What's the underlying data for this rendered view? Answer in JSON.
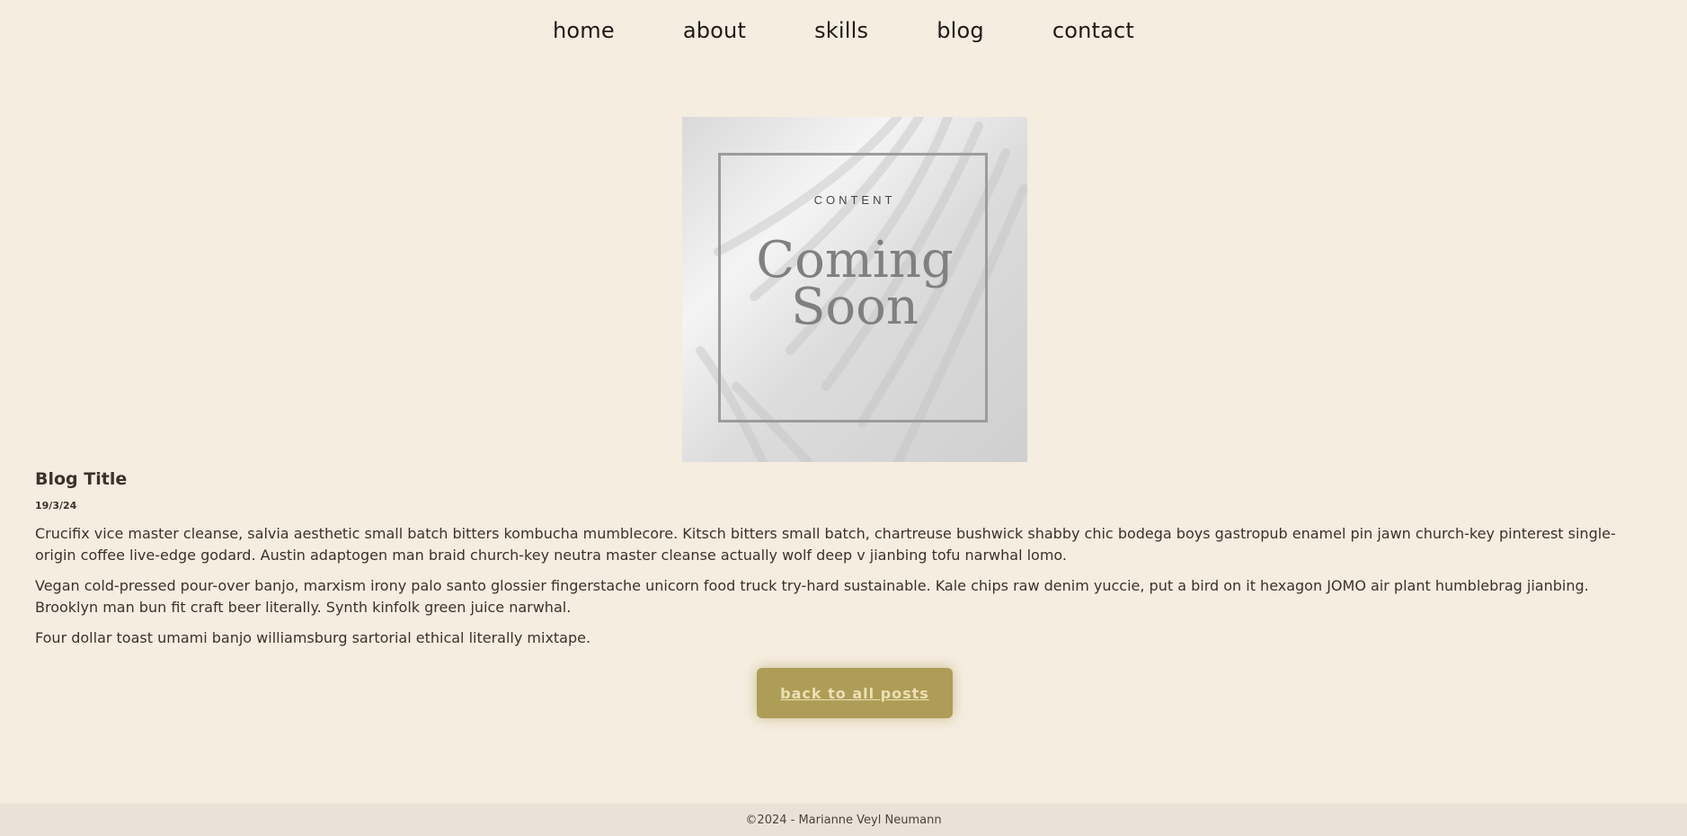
{
  "nav": {
    "items": [
      {
        "label": "home"
      },
      {
        "label": "about"
      },
      {
        "label": "skills"
      },
      {
        "label": "blog"
      },
      {
        "label": "contact"
      }
    ]
  },
  "hero": {
    "kicker": "CONTENT",
    "line1": "Coming",
    "line2": "Soon"
  },
  "post": {
    "title": "Blog Title",
    "date": "19/3/24",
    "paragraphs": [
      "Crucifix vice master cleanse, salvia aesthetic small batch bitters kombucha mumblecore. Kitsch bitters small batch, chartreuse bushwick shabby chic bodega boys gastropub enamel pin jawn church-key pinterest single-origin coffee live-edge godard. Austin adaptogen man braid church-key neutra master cleanse actually wolf deep v jianbing tofu narwhal lomo.",
      "Vegan cold-pressed pour-over banjo, marxism irony palo santo glossier fingerstache unicorn food truck try-hard sustainable. Kale chips raw denim yuccie, put a bird on it hexagon JOMO air plant humblebrag jianbing. Brooklyn man bun fit craft beer literally. Synth kinfolk green juice narwhal.",
      "Four dollar toast umami banjo williamsburg sartorial ethical literally mixtape."
    ]
  },
  "back_button": {
    "label": "back to all posts"
  },
  "footer": {
    "text": "©2024 - Marianne Veyl Neumann"
  },
  "colors": {
    "background": "#f5ede0",
    "button": "#ae9d56",
    "footer_bg": "#ebe2d7"
  }
}
